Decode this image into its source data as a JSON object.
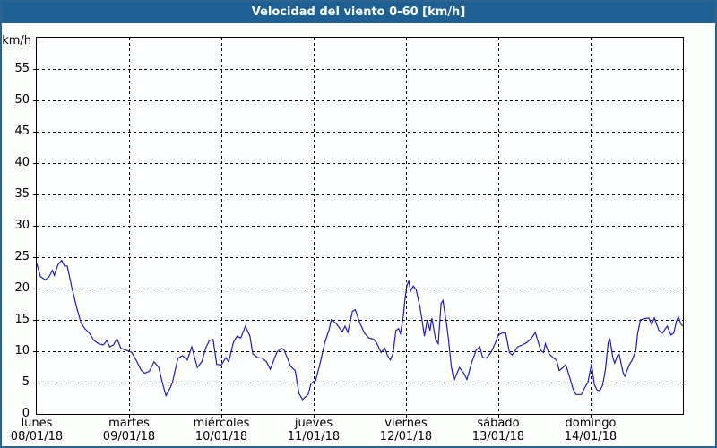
{
  "title_bar": {
    "text": "Velocidad del viento 0-60 [km/h]"
  },
  "colors": {
    "title_bg": "#1e6094",
    "title_fg": "#ffffff",
    "frame_border": "#2d638f",
    "panel_bg": "#fdfffd",
    "plot_bg": "#feffff",
    "grid": "#000000",
    "line": "#1c1cbe",
    "text": "#000000"
  },
  "chart_data": {
    "type": "line",
    "title": "Velocidad del viento 0-60 [km/h]",
    "ylabel": "km/h",
    "xlabel": "",
    "ylim": [
      0,
      60
    ],
    "ytick_step": 5,
    "ytick_labels": [
      0,
      5,
      10,
      15,
      20,
      25,
      30,
      35,
      40,
      45,
      50,
      55
    ],
    "grid": "dashed",
    "legend_position": "none",
    "x_days": [
      {
        "name": "lunes",
        "date": "08/01/18"
      },
      {
        "name": "martes",
        "date": "09/01/18"
      },
      {
        "name": "miércoles",
        "date": "10/01/18"
      },
      {
        "name": "jueves",
        "date": "11/01/18"
      },
      {
        "name": "viernes",
        "date": "12/01/18"
      },
      {
        "name": "sábado",
        "date": "13/01/18"
      },
      {
        "name": "domingo",
        "date": "14/01/18"
      }
    ],
    "series": [
      {
        "name": "Velocidad del viento [km/h]",
        "x_unit": "days_from_2018-01-08",
        "points": [
          [
            0.0,
            24.0
          ],
          [
            0.04,
            21.9
          ],
          [
            0.09,
            21.4
          ],
          [
            0.13,
            21.8
          ],
          [
            0.17,
            22.9
          ],
          [
            0.19,
            22.1
          ],
          [
            0.23,
            23.8
          ],
          [
            0.27,
            24.5
          ],
          [
            0.3,
            23.6
          ],
          [
            0.33,
            23.6
          ],
          [
            0.38,
            20.2
          ],
          [
            0.43,
            17.1
          ],
          [
            0.48,
            14.5
          ],
          [
            0.52,
            13.6
          ],
          [
            0.57,
            12.9
          ],
          [
            0.62,
            11.7
          ],
          [
            0.67,
            11.2
          ],
          [
            0.72,
            11.0
          ],
          [
            0.76,
            11.7
          ],
          [
            0.79,
            10.7
          ],
          [
            0.83,
            11.0
          ],
          [
            0.87,
            12.0
          ],
          [
            0.91,
            10.5
          ],
          [
            0.96,
            10.2
          ],
          [
            1.0,
            10.0
          ],
          [
            1.03,
            9.8
          ],
          [
            1.08,
            8.5
          ],
          [
            1.13,
            7.0
          ],
          [
            1.17,
            6.5
          ],
          [
            1.22,
            6.8
          ],
          [
            1.27,
            8.3
          ],
          [
            1.32,
            7.5
          ],
          [
            1.36,
            5.0
          ],
          [
            1.4,
            2.9
          ],
          [
            1.44,
            4.0
          ],
          [
            1.47,
            5.0
          ],
          [
            1.5,
            7.0
          ],
          [
            1.53,
            8.9
          ],
          [
            1.58,
            9.3
          ],
          [
            1.63,
            8.6
          ],
          [
            1.68,
            10.7
          ],
          [
            1.71,
            9.0
          ],
          [
            1.74,
            7.4
          ],
          [
            1.79,
            8.4
          ],
          [
            1.83,
            10.5
          ],
          [
            1.87,
            11.7
          ],
          [
            1.91,
            11.9
          ],
          [
            1.95,
            7.9
          ],
          [
            2.0,
            7.8
          ],
          [
            2.05,
            9.0
          ],
          [
            2.08,
            8.3
          ],
          [
            2.13,
            11.4
          ],
          [
            2.17,
            12.4
          ],
          [
            2.21,
            12.1
          ],
          [
            2.26,
            14.0
          ],
          [
            2.31,
            12.4
          ],
          [
            2.34,
            9.6
          ],
          [
            2.39,
            9.0
          ],
          [
            2.44,
            8.9
          ],
          [
            2.49,
            8.3
          ],
          [
            2.53,
            7.1
          ],
          [
            2.6,
            9.8
          ],
          [
            2.65,
            10.5
          ],
          [
            2.68,
            10.2
          ],
          [
            2.75,
            7.6
          ],
          [
            2.8,
            6.9
          ],
          [
            2.84,
            3.3
          ],
          [
            2.88,
            2.3
          ],
          [
            2.94,
            3.1
          ],
          [
            2.97,
            4.8
          ],
          [
            3.0,
            5.2
          ],
          [
            3.02,
            5.3
          ],
          [
            3.07,
            8.1
          ],
          [
            3.12,
            11.4
          ],
          [
            3.17,
            13.6
          ],
          [
            3.19,
            15.0
          ],
          [
            3.24,
            14.5
          ],
          [
            3.31,
            13.1
          ],
          [
            3.34,
            14.0
          ],
          [
            3.37,
            13.0
          ],
          [
            3.42,
            16.4
          ],
          [
            3.45,
            16.6
          ],
          [
            3.5,
            14.5
          ],
          [
            3.55,
            12.9
          ],
          [
            3.6,
            12.1
          ],
          [
            3.65,
            11.9
          ],
          [
            3.68,
            11.4
          ],
          [
            3.73,
            9.8
          ],
          [
            3.77,
            10.5
          ],
          [
            3.8,
            9.3
          ],
          [
            3.83,
            8.6
          ],
          [
            3.86,
            9.7
          ],
          [
            3.89,
            13.3
          ],
          [
            3.92,
            13.6
          ],
          [
            3.94,
            12.8
          ],
          [
            3.97,
            15.5
          ],
          [
            3.99,
            18.5
          ],
          [
            4.01,
            20.5
          ],
          [
            4.03,
            21.2
          ],
          [
            4.05,
            19.6
          ],
          [
            4.08,
            20.4
          ],
          [
            4.11,
            19.8
          ],
          [
            4.15,
            17.1
          ],
          [
            4.17,
            15.3
          ],
          [
            4.2,
            12.4
          ],
          [
            4.23,
            15.0
          ],
          [
            4.26,
            13.3
          ],
          [
            4.28,
            15.3
          ],
          [
            4.32,
            11.9
          ],
          [
            4.35,
            11.2
          ],
          [
            4.38,
            17.6
          ],
          [
            4.4,
            18.1
          ],
          [
            4.44,
            14.3
          ],
          [
            4.46,
            11.9
          ],
          [
            4.49,
            7.6
          ],
          [
            4.52,
            5.3
          ],
          [
            4.55,
            6.4
          ],
          [
            4.58,
            7.4
          ],
          [
            4.63,
            6.4
          ],
          [
            4.66,
            5.5
          ],
          [
            4.71,
            8.1
          ],
          [
            4.76,
            10.2
          ],
          [
            4.8,
            10.7
          ],
          [
            4.83,
            9.0
          ],
          [
            4.87,
            8.9
          ],
          [
            4.92,
            9.8
          ],
          [
            4.97,
            11.4
          ],
          [
            5.0,
            12.6
          ],
          [
            5.04,
            12.9
          ],
          [
            5.08,
            12.9
          ],
          [
            5.12,
            9.8
          ],
          [
            5.15,
            9.4
          ],
          [
            5.21,
            10.7
          ],
          [
            5.26,
            11.0
          ],
          [
            5.31,
            11.4
          ],
          [
            5.36,
            12.1
          ],
          [
            5.4,
            13.0
          ],
          [
            5.46,
            10.1
          ],
          [
            5.49,
            9.8
          ],
          [
            5.51,
            11.2
          ],
          [
            5.55,
            9.6
          ],
          [
            5.6,
            8.9
          ],
          [
            5.63,
            8.6
          ],
          [
            5.66,
            6.9
          ],
          [
            5.7,
            7.4
          ],
          [
            5.73,
            7.9
          ],
          [
            5.78,
            5.5
          ],
          [
            5.81,
            4.0
          ],
          [
            5.84,
            3.1
          ],
          [
            5.9,
            3.1
          ],
          [
            5.94,
            4.3
          ],
          [
            5.97,
            5.0
          ],
          [
            5.99,
            6.5
          ],
          [
            6.01,
            8.0
          ],
          [
            6.04,
            4.7
          ],
          [
            6.07,
            3.8
          ],
          [
            6.1,
            3.7
          ],
          [
            6.13,
            4.6
          ],
          [
            6.16,
            7.1
          ],
          [
            6.19,
            11.4
          ],
          [
            6.21,
            11.9
          ],
          [
            6.24,
            9.0
          ],
          [
            6.26,
            8.1
          ],
          [
            6.29,
            9.3
          ],
          [
            6.31,
            9.5
          ],
          [
            6.35,
            6.7
          ],
          [
            6.37,
            6.0
          ],
          [
            6.42,
            7.9
          ],
          [
            6.45,
            8.6
          ],
          [
            6.49,
            10.2
          ],
          [
            6.51,
            12.9
          ],
          [
            6.54,
            15.0
          ],
          [
            6.58,
            15.2
          ],
          [
            6.63,
            15.3
          ],
          [
            6.66,
            14.3
          ],
          [
            6.69,
            15.3
          ],
          [
            6.74,
            13.3
          ],
          [
            6.78,
            12.9
          ],
          [
            6.81,
            13.6
          ],
          [
            6.83,
            14.0
          ],
          [
            6.87,
            12.6
          ],
          [
            6.9,
            12.9
          ],
          [
            6.93,
            14.8
          ],
          [
            6.95,
            15.5
          ],
          [
            6.98,
            14.3
          ],
          [
            7.0,
            14.0
          ]
        ]
      }
    ]
  }
}
